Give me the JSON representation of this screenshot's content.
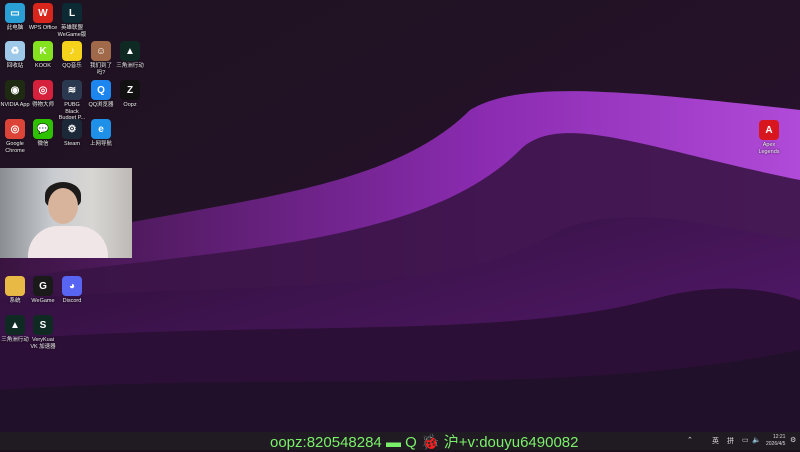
{
  "desktop_icons": [
    {
      "label": "此电脑",
      "icon": "monitor-icon",
      "color": "#2a9fd6",
      "glyph": "▭"
    },
    {
      "label": "WPS Office",
      "icon": "wps-icon",
      "color": "#d9261c",
      "glyph": "W"
    },
    {
      "label": "英雄联盟 WeGame版",
      "icon": "lol-icon",
      "color": "#0c2a33",
      "glyph": "L"
    },
    {
      "label": "回收站",
      "icon": "recycle-bin-icon",
      "color": "#9ec9e8",
      "glyph": "♻"
    },
    {
      "label": "KOOK",
      "icon": "kook-icon",
      "color": "#85e21f",
      "glyph": "K"
    },
    {
      "label": "QQ音乐",
      "icon": "qq-music-icon",
      "color": "#f5d21b",
      "glyph": "♪"
    },
    {
      "label": "我们到了吗?",
      "icon": "game-icon",
      "color": "#a06a4a",
      "glyph": "☺"
    },
    {
      "label": "三角洲行动",
      "icon": "delta-force-icon",
      "color": "#0f2a22",
      "glyph": "▲"
    },
    {
      "label": "NVIDIA App",
      "icon": "nvidia-icon",
      "color": "#1f2a12",
      "glyph": "◉"
    },
    {
      "label": "得物大师",
      "icon": "app-icon",
      "color": "#d5213c",
      "glyph": "◎"
    },
    {
      "label": "PUBG Black Budget P...",
      "icon": "pubg-icon",
      "color": "#2b3950",
      "glyph": "≋"
    },
    {
      "label": "QQ浏览器",
      "icon": "qq-browser-icon",
      "color": "#1c86ee",
      "glyph": "Q"
    },
    {
      "label": "Oopz",
      "icon": "oopz-icon",
      "color": "#111",
      "glyph": "Z"
    },
    {
      "label": "Google Chrome",
      "icon": "chrome-icon",
      "color": "#db4437",
      "glyph": "◎"
    },
    {
      "label": "微信",
      "icon": "wechat-icon",
      "color": "#2dc100",
      "glyph": "💬"
    },
    {
      "label": "Steam",
      "icon": "steam-icon",
      "color": "#1b2838",
      "glyph": "⚙"
    },
    {
      "label": "上网导航",
      "icon": "ie-icon",
      "color": "#1e90e8",
      "glyph": "e"
    },
    {
      "label": "系统",
      "icon": "folder-icon",
      "color": "#e8b945",
      "glyph": ""
    },
    {
      "label": "WeGame",
      "icon": "wegame-icon",
      "color": "#1a1a1a",
      "glyph": "G"
    },
    {
      "label": "Discord",
      "icon": "discord-icon",
      "color": "#5865f2",
      "glyph": "◕"
    },
    {
      "label": "三角洲行动",
      "icon": "delta-force-icon",
      "color": "#0f2a22",
      "glyph": "▲"
    },
    {
      "label": "VeryKuai VK 加速器",
      "icon": "verykuai-icon",
      "color": "#0f2a22",
      "glyph": "S"
    },
    {
      "label": "Apex Legends",
      "icon": "apex-icon",
      "color": "#d8161e",
      "glyph": "A"
    }
  ],
  "overlay_text": "oopz:820548284 ▬ Q 🐞 沪+v:douyu6490082",
  "tray": {
    "ime1": "英",
    "ime2": "拼",
    "time": "12:21",
    "date": "2026/4/5"
  }
}
